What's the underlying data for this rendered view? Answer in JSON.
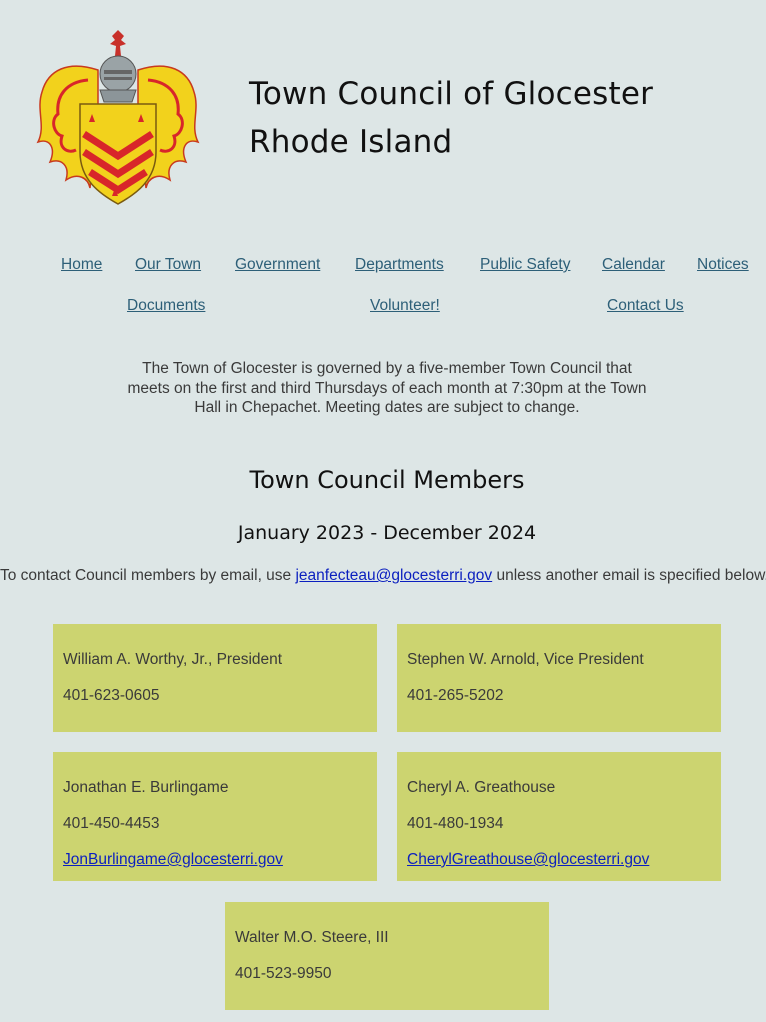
{
  "header": {
    "title_line1": "Town Council of Glocester",
    "title_line2": "Rhode Island",
    "logo": "town-coat-of-arms"
  },
  "nav": {
    "items": [
      "Home",
      "Our Town",
      "Government",
      "Departments",
      "Public Safety",
      "Calendar",
      "Notices",
      "Documents",
      "Volunteer!",
      "Contact Us"
    ]
  },
  "intro": "The Town of Glocester is governed by a five-member Town Council that meets on the first and third Thursdays of each month at 7:30pm at the Town Hall in Chepachet. Meeting dates are subject to change.",
  "members_heading": "Town Council Members",
  "term": "January 2023 - December 2024",
  "contact": {
    "prefix": "To contact Council members by email, use ",
    "email": "jeanfecteau@glocesterri.gov",
    "suffix": " unless another email is specified below."
  },
  "members": [
    {
      "name": "William A. Worthy, Jr., President",
      "phone": "401-623-0605",
      "email": ""
    },
    {
      "name": "Stephen W. Arnold, Vice President",
      "phone": "401-265-5202",
      "email": ""
    },
    {
      "name": "Jonathan E. Burlingame",
      "phone": "401-450-4453",
      "email": "JonBurlingame@glocesterri.gov"
    },
    {
      "name": "Cheryl A. Greathouse",
      "phone": "401-480-1934",
      "email": "CherylGreathouse@glocesterri.gov"
    },
    {
      "name": "Walter M.O. Steere, III",
      "phone": "401-523-9950",
      "email": ""
    }
  ],
  "colors": {
    "background": "#dde6e6",
    "card": "#ccd470",
    "nav_link": "#2d5f78",
    "email_link": "#0b1fbf",
    "crest_shield": "#f2d21c",
    "crest_chevrons": "#d8262a"
  }
}
